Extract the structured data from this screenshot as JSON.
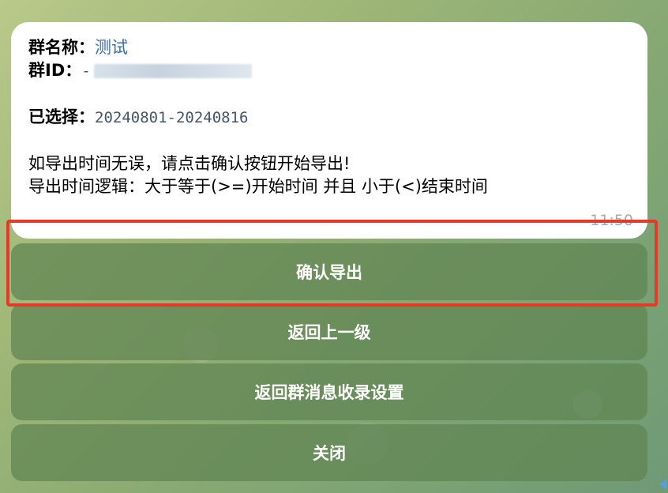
{
  "message": {
    "group_name_label": "群名称",
    "group_name_value": "测试",
    "group_id_label": "群ID",
    "group_id_prefix": "-",
    "selected_label": "已选择",
    "selected_value": "20240801-20240816",
    "line_confirm": "如导出时间无误，请点击确认按钮开始导出!",
    "line_logic": "导出时间逻辑：大于等于(>=)开始时间 并且 小于(<)结束时间",
    "timestamp": "11:50"
  },
  "buttons": {
    "confirm_export": "确认导出",
    "back_one_level": "返回上一级",
    "back_to_settings": "返回群消息收录设置",
    "close": "关闭"
  },
  "colors": {
    "highlight": "#e53a2a",
    "button_bg": "#608452",
    "link": "#3a6fa8"
  }
}
